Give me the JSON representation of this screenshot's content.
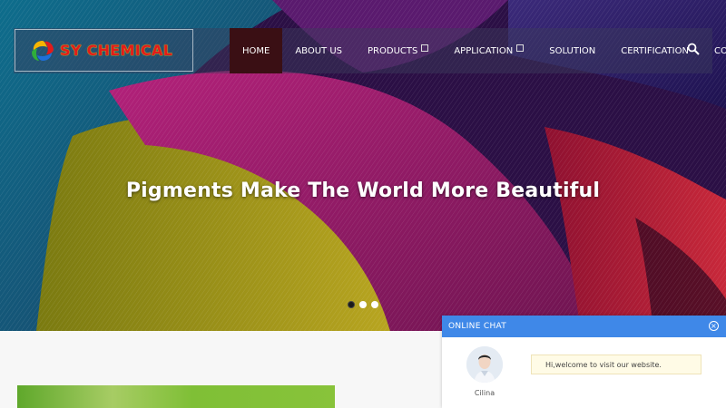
{
  "header": {
    "logo_text": "SY CHEMICAL",
    "nav": [
      {
        "label": "HOME",
        "active": true
      },
      {
        "label": "ABOUT US"
      },
      {
        "label": "PRODUCTS",
        "has_submenu": true
      },
      {
        "label": "APPLICATION",
        "has_submenu": true
      },
      {
        "label": "SOLUTION"
      },
      {
        "label": "CERTIFICATION"
      },
      {
        "label": "CONTACT"
      }
    ],
    "search_icon": "search-icon"
  },
  "hero": {
    "title": "Pigments Make The World More Beautiful",
    "slide_count": 3,
    "active_slide": 1
  },
  "chat": {
    "title": "ONLINE CHAT",
    "agent_name": "Cilina",
    "message": "Hi,welcome to visit our website.",
    "close_icon": "close-icon"
  },
  "colors": {
    "nav_active": "#3a0f14",
    "chat_bar": "#3f88e8",
    "logo_text": "#e21b1b",
    "bubble_bg": "#fffbe6"
  }
}
